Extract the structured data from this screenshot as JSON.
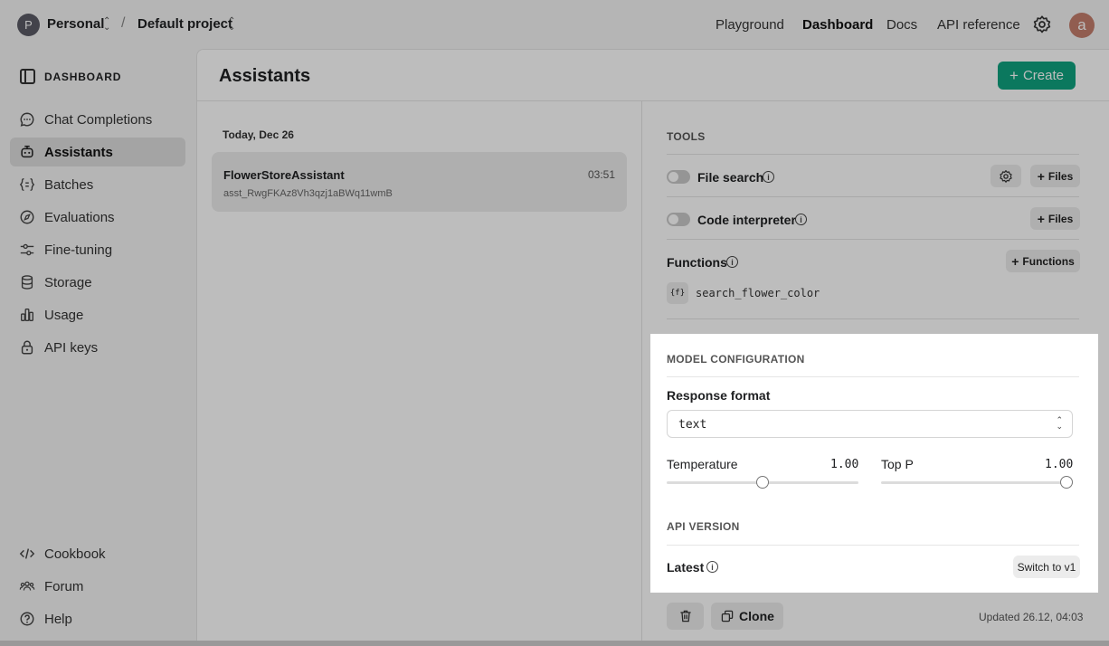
{
  "topbar": {
    "org_initial": "P",
    "org_name": "Personal",
    "separator": "/",
    "project_name": "Default project",
    "nav": [
      "Playground",
      "Dashboard",
      "Docs",
      "API reference"
    ],
    "active_nav": "Dashboard",
    "user_initial": "a"
  },
  "sidebar": {
    "title": "DASHBOARD",
    "items": [
      {
        "label": "Chat Completions",
        "icon": "chat-bubble-icon"
      },
      {
        "label": "Assistants",
        "icon": "robot-icon",
        "active": true
      },
      {
        "label": "Batches",
        "icon": "braces-icon"
      },
      {
        "label": "Evaluations",
        "icon": "compass-icon"
      },
      {
        "label": "Fine-tuning",
        "icon": "sliders-icon"
      },
      {
        "label": "Storage",
        "icon": "database-icon"
      },
      {
        "label": "Usage",
        "icon": "bar-chart-icon"
      },
      {
        "label": "API keys",
        "icon": "lock-icon"
      }
    ],
    "bottom_items": [
      {
        "label": "Cookbook",
        "icon": "code-icon"
      },
      {
        "label": "Forum",
        "icon": "people-icon"
      },
      {
        "label": "Help",
        "icon": "question-icon"
      }
    ]
  },
  "main": {
    "title": "Assistants",
    "create_label": "Create",
    "list": {
      "date_heading": "Today, Dec 26",
      "assistants": [
        {
          "name": "FlowerStoreAssistant",
          "id": "asst_RwgFKAz8Vh3qzj1aBWq11wmB",
          "time": "03:51"
        }
      ]
    }
  },
  "detail": {
    "tools_label": "TOOLS",
    "file_search": {
      "label": "File search",
      "files_label": "Files"
    },
    "code_interpreter": {
      "label": "Code interpreter",
      "files_label": "Files"
    },
    "functions": {
      "label": "Functions",
      "add_label": "Functions",
      "icon_text": "{f}",
      "items": [
        "search_flower_color"
      ]
    },
    "model_config": {
      "label": "MODEL CONFIGURATION",
      "response_format_label": "Response format",
      "response_format_value": "text",
      "temperature": {
        "label": "Temperature",
        "value": "1.00",
        "fraction": 0.5
      },
      "top_p": {
        "label": "Top P",
        "value": "1.00",
        "fraction": 1.0
      }
    },
    "api_version": {
      "label": "API VERSION",
      "current": "Latest",
      "switch_label": "Switch to v1"
    },
    "footer": {
      "clone_label": "Clone",
      "updated": "Updated 26.12, 04:03"
    }
  },
  "colors": {
    "accent": "#10a37f",
    "overlay": "rgba(0,0,0,0.26)"
  }
}
